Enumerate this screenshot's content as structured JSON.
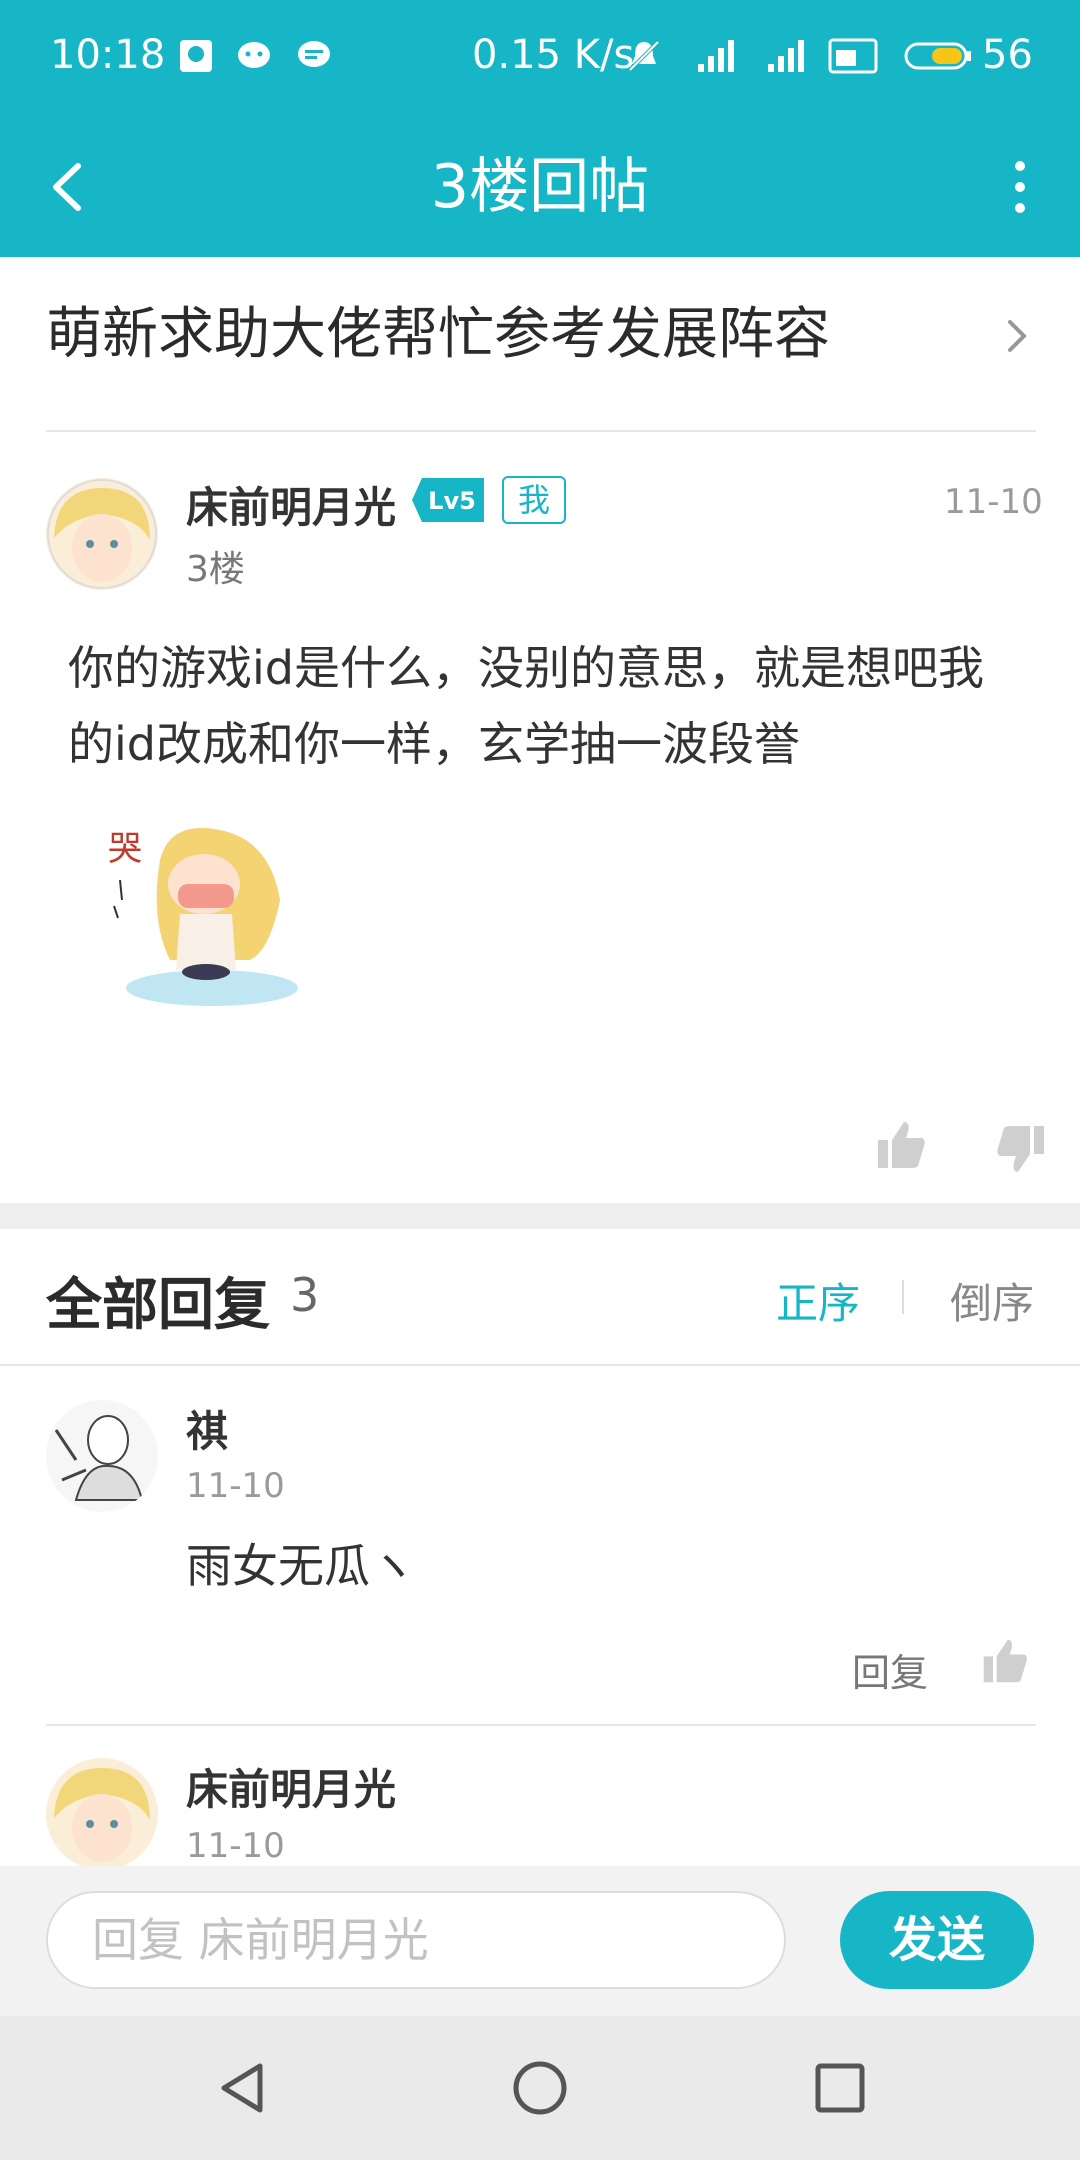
{
  "status_bar": {
    "time": "10:18",
    "net_speed": "0.15 K/s",
    "battery": "56"
  },
  "header": {
    "title": "3楼回帖"
  },
  "post": {
    "title": "萌新求助大佬帮忙参考发展阵容",
    "author": "床前明月光",
    "level": "Lv5",
    "me_badge": "我",
    "floor": "3楼",
    "date": "11-10",
    "content": "你的游戏id是什么，没别的意思，就是想吧我的id改成和你一样，玄学抽一波段誉",
    "sticker_caption": "哭"
  },
  "replies_section": {
    "title": "全部回复",
    "count": "3",
    "sort_asc": "正序",
    "sort_desc": "倒序"
  },
  "replies": [
    {
      "author": "祺",
      "date": "11-10",
      "text": "雨女无瓜ヽ",
      "reply_label": "回复"
    },
    {
      "author": "床前明月光",
      "date": "11-10"
    }
  ],
  "input_bar": {
    "placeholder": "回复 床前明月光",
    "send_label": "发送"
  },
  "colors": {
    "accent": "#16b6c7"
  }
}
